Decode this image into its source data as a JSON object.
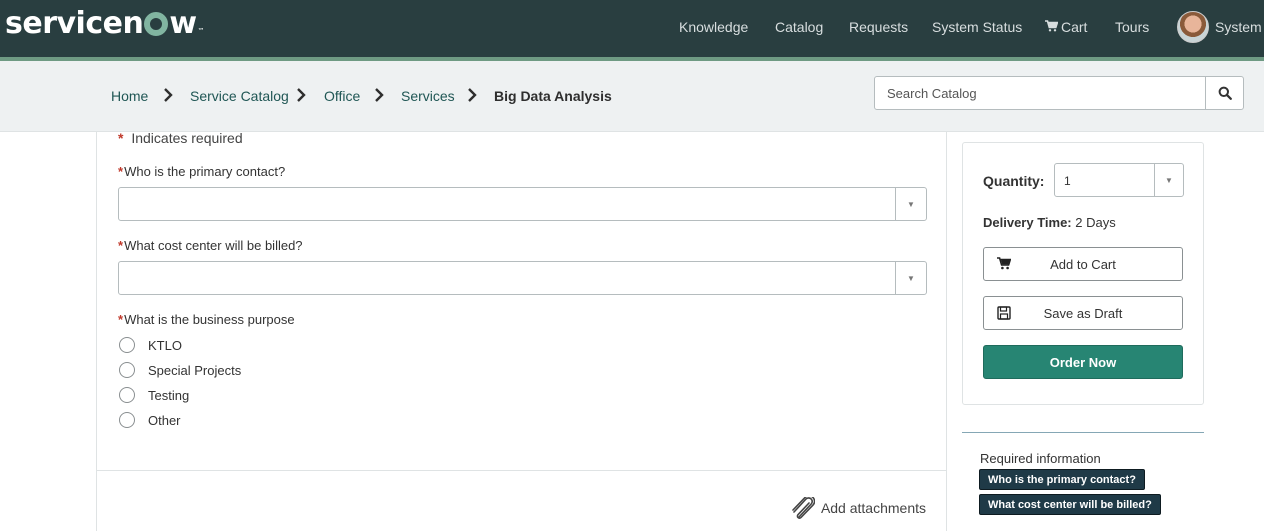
{
  "header": {
    "logo_text_left": "servicen",
    "logo_text_right": "w",
    "logo_tm": "™",
    "nav": {
      "knowledge": "Knowledge",
      "catalog": "Catalog",
      "requests": "Requests",
      "system_status": "System Status",
      "cart": "Cart",
      "tours": "Tours",
      "user": "System A"
    }
  },
  "breadcrumb": {
    "items": [
      "Home",
      "Service Catalog",
      "Office",
      "Services"
    ],
    "current": "Big Data Analysis"
  },
  "search": {
    "placeholder": "Search Catalog"
  },
  "form": {
    "required_note": "Indicates required",
    "required_star": "*",
    "q1": "Who is the primary contact?",
    "q1_value": "",
    "q2": "What cost center will be billed?",
    "q2_value": "",
    "q3": "What is the business purpose",
    "options": [
      "KTLO",
      "Special Projects",
      "Testing",
      "Other"
    ],
    "attach": "Add attachments"
  },
  "order": {
    "quantity_label": "Quantity:",
    "quantity_value": "1",
    "delivery_label": "Delivery Time:",
    "delivery_value": "2 Days",
    "add_to_cart": "Add to Cart",
    "save_draft": "Save as Draft",
    "order_now": "Order Now"
  },
  "required_info": {
    "title": "Required information",
    "items": [
      "Who is the primary contact?",
      "What cost center will be billed?"
    ]
  },
  "colors": {
    "header_bg": "#293e40",
    "accent_green": "#81b5a1",
    "primary_button": "#278573",
    "required_star": "#c0392b"
  }
}
